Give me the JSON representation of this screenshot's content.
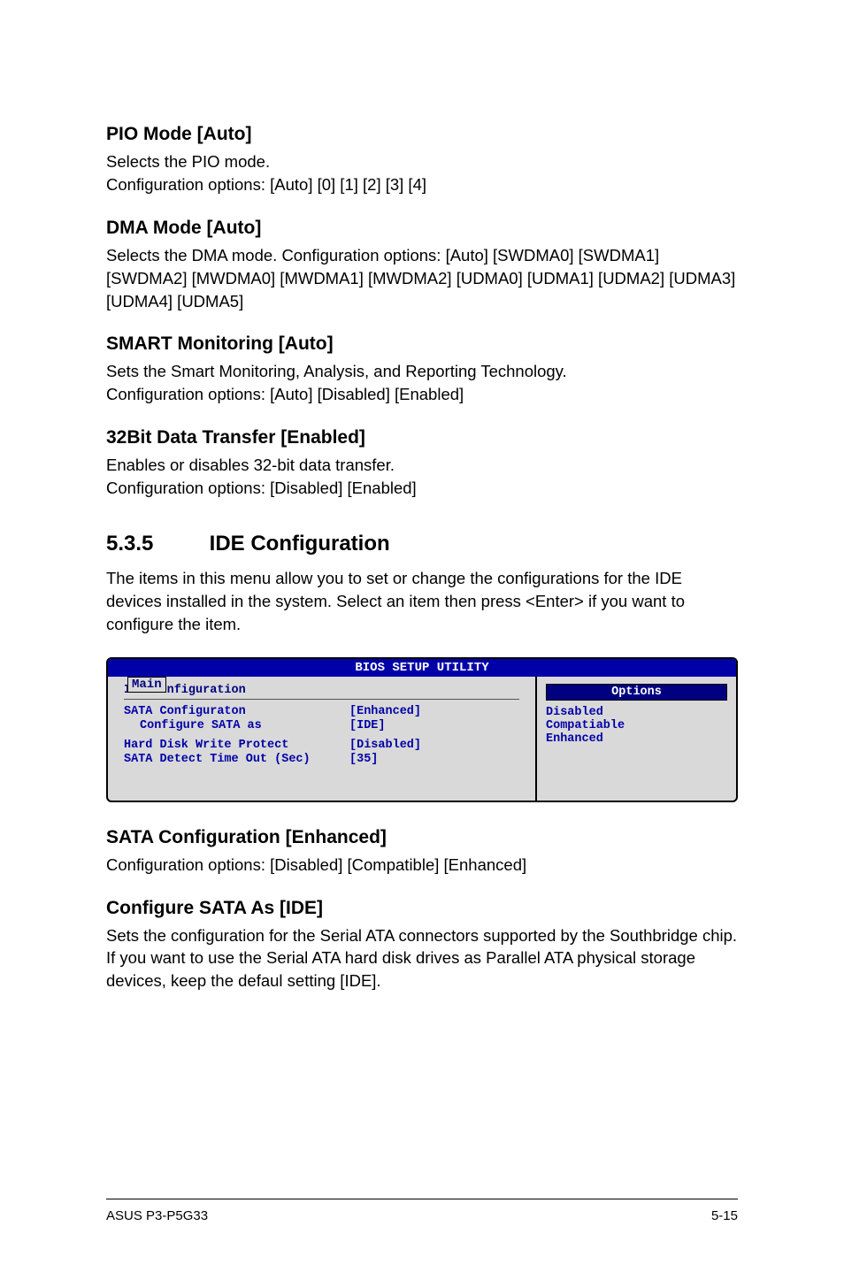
{
  "section1": {
    "title": "PIO Mode [Auto]",
    "line1": "Selects the PIO mode.",
    "line2": "Configuration options: [Auto] [0] [1] [2] [3] [4]"
  },
  "section2": {
    "title": "DMA Mode [Auto]",
    "body": "Selects the DMA mode. Configuration options: [Auto] [SWDMA0] [SWDMA1] [SWDMA2] [MWDMA0] [MWDMA1] [MWDMA2] [UDMA0] [UDMA1] [UDMA2] [UDMA3] [UDMA4] [UDMA5]"
  },
  "section3": {
    "title": "SMART Monitoring [Auto]",
    "line1": "Sets the Smart Monitoring, Analysis, and Reporting Technology.",
    "line2": "Configuration options: [Auto] [Disabled] [Enabled]"
  },
  "section4": {
    "title": "32Bit Data Transfer [Enabled]",
    "line1": "Enables or disables 32-bit data transfer.",
    "line2": "Configuration options: [Disabled] [Enabled]"
  },
  "ide_section": {
    "num": "5.3.5",
    "title": "IDE Configuration",
    "body": "The items in this menu allow you to set or change the configurations for the IDE devices installed in the system. Select an item then press <Enter> if you want to configure the item."
  },
  "bios": {
    "titlebar": "BIOS SETUP UTILITY",
    "tab": "Main",
    "header": "IDE Configuration",
    "rows": [
      {
        "label": "SATA Configuraton",
        "value": "[Enhanced]"
      },
      {
        "label": "Configure SATA as",
        "value": "[IDE]",
        "indent": true
      },
      {
        "label": "Hard Disk Write Protect",
        "value": "[Disabled]",
        "gap": true
      },
      {
        "label": "SATA Detect Time Out (Sec)",
        "value": "[35]"
      }
    ],
    "optionsHeader": "Options",
    "options": [
      "Disabled",
      "Compatiable",
      "Enhanced"
    ]
  },
  "section5": {
    "title": "SATA Configuration [Enhanced]",
    "body": "Configuration options: [Disabled] [Compatible] [Enhanced]"
  },
  "section6": {
    "title": "Configure SATA As [IDE]",
    "body": "Sets the configuration for the Serial ATA connectors supported by the Southbridge chip. If you want to use the Serial ATA hard disk drives as Parallel ATA physical storage devices, keep the defaul setting [IDE]."
  },
  "footer": {
    "left": "ASUS P3-P5G33",
    "right": "5-15"
  }
}
